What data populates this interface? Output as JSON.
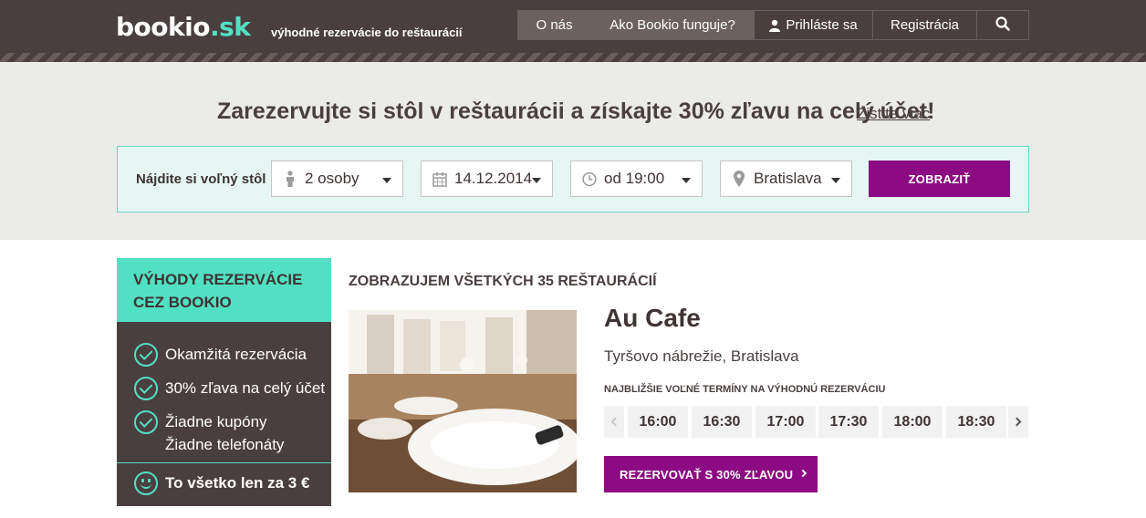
{
  "header": {
    "logo_main": "bookio",
    "logo_dot": ".sk",
    "tagline": "výhodné rezervácie do reštaurácií",
    "nav": {
      "about": "O nás",
      "how": "Ako Bookio funguje?",
      "login": "Prihláste sa",
      "register": "Registrácia"
    },
    "search_icon": "search-icon"
  },
  "hero": {
    "title": "Zarezervujte si stôl v reštaurácii a získajte 30% zľavu na celý účet!",
    "link": "Zistite viac"
  },
  "search": {
    "label": "Nájdite si voľný stôl",
    "people": "2 osoby",
    "date": "14.12.2014",
    "time": "od 19:00",
    "city": "Bratislava",
    "button": "ZOBRAZIŤ"
  },
  "sidebar": {
    "heading": "Výhody rezervácie cez Bookio",
    "benefits": [
      "Okamžitá rezervácia",
      "30% zľava na celý účet",
      "Žiadne kupóny",
      "Žiadne telefonáty"
    ],
    "price": "To všetko len za 3 €"
  },
  "listing": {
    "count": "Zobrazujem všetkých 35 reštaurácií",
    "restaurant": {
      "name": "Au Cafe",
      "address": "Tyršovo nábrežie, Bratislava",
      "slots_label": "Najbližšie voľné termíny na výhodnú rezerváciu",
      "slots": [
        "16:00",
        "16:30",
        "17:00",
        "17:30",
        "18:00",
        "18:30"
      ],
      "book_button": "REZERVOVAŤ S 30% ZĽAVOU"
    }
  },
  "colors": {
    "header_bg": "#4a3f3f",
    "accent_teal": "#52e0c4",
    "accent_purple": "#8c0b82",
    "hero_bg": "#ebebe9"
  }
}
